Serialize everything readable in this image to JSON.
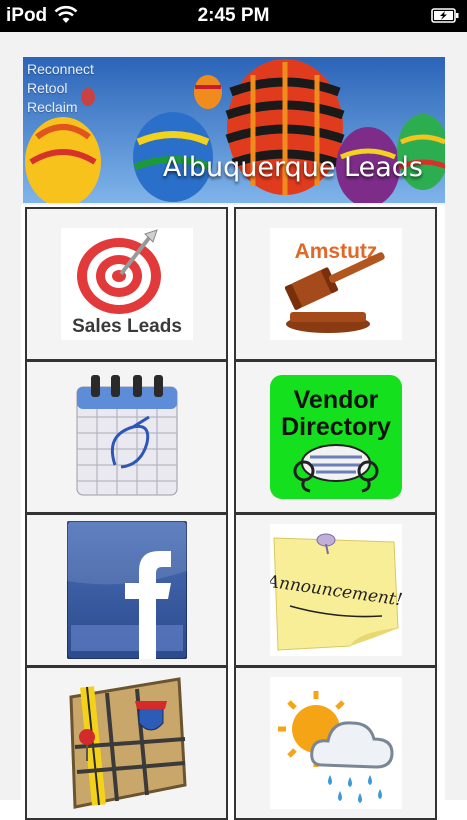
{
  "statusbar": {
    "carrier": "iPod",
    "time": "2:45 PM"
  },
  "banner": {
    "taglines": [
      "Reconnect",
      "Retool",
      "Reclaim"
    ],
    "title": "Albuquerque Leads"
  },
  "tiles": {
    "sales_leads": {
      "label": "Sales Leads",
      "icon": "target-icon"
    },
    "amstutz": {
      "label": "Amstutz",
      "icon": "gavel-icon"
    },
    "calendar": {
      "icon": "calendar-icon"
    },
    "vendor_directory": {
      "label_line1": "Vendor",
      "label_line2": "Directory",
      "icon": "rolodex-icon"
    },
    "facebook": {
      "icon": "facebook-icon",
      "letter": "f"
    },
    "announcement": {
      "label": "Announcement!",
      "icon": "sticky-note-icon"
    },
    "map": {
      "icon": "map-icon"
    },
    "weather": {
      "icon": "weather-icon"
    }
  },
  "colors": {
    "statusbar_bg": "#000000",
    "vendor_green": "#14e01e",
    "facebook_blue": "#3b5998",
    "sticky_yellow": "#f9ee98"
  }
}
